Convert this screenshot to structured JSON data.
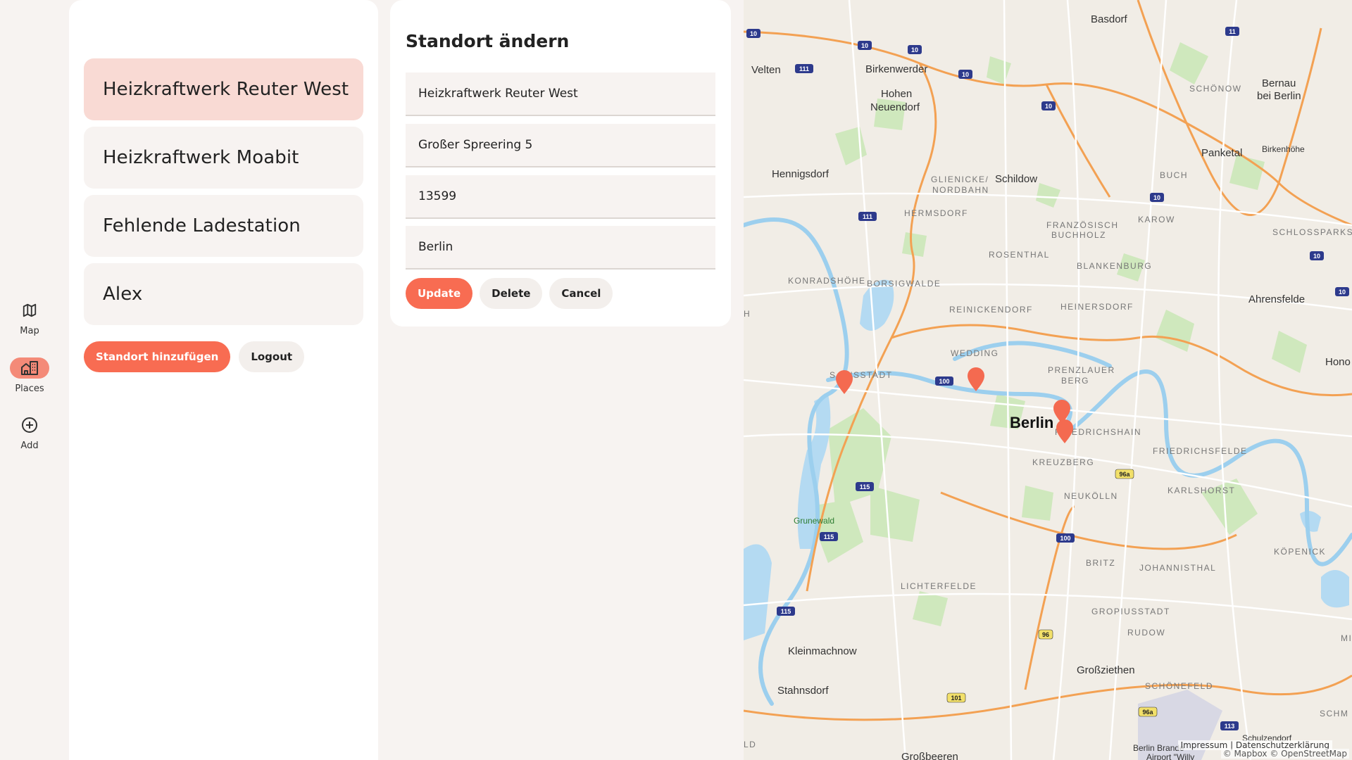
{
  "nav": {
    "items": [
      {
        "label": "Map",
        "icon": "map-icon",
        "active": false
      },
      {
        "label": "Places",
        "icon": "building-icon",
        "active": true
      },
      {
        "label": "Add",
        "icon": "plus-circle-icon",
        "active": false
      }
    ]
  },
  "places": {
    "items": [
      {
        "label": "Heizkraftwerk Reuter West",
        "selected": true
      },
      {
        "label": "Heizkraftwerk Moabit",
        "selected": false
      },
      {
        "label": "Fehlende Ladestation",
        "selected": false
      },
      {
        "label": "Alex",
        "selected": false
      }
    ],
    "add_label": "Standort hinzufügen",
    "logout_label": "Logout"
  },
  "editor": {
    "title": "Standort ändern",
    "name_value": "Heizkraftwerk Reuter West",
    "street_value": "Großer Spreering 5",
    "zip_value": "13599",
    "city_value": "Berlin",
    "update_label": "Update",
    "delete_label": "Delete",
    "cancel_label": "Cancel"
  },
  "map": {
    "labels": {
      "berlin": "Berlin",
      "basdorf": "Basdorf",
      "velten": "Velten",
      "birkenwerder": "Birkenwerder",
      "hohen": "Hohen",
      "neuendorf": "Neuendorf",
      "bernau": "Bernau",
      "bei_berlin": "bei Berlin",
      "schonow": "SCHÖNOW",
      "panketal": "Panketal",
      "birkenhohe": "Birkenhöhe",
      "hennigsdorf": "Hennigsdorf",
      "schildow": "Schildow",
      "glienicke": "GLIENICKE/",
      "nordbahn": "NORDBAHN",
      "buch": "BUCH",
      "hermsdorf": "HERMSDORF",
      "franzosisch": "FRANZÖSISCH",
      "buchholz": "BUCHHOLZ",
      "karow": "KAROW",
      "schlosspark": "SCHLOSSPARKS",
      "rosenthal": "ROSENTHAL",
      "blankenburg": "BLANKENBURG",
      "konradshohe": "KONRADSHÖHE",
      "borsigwalde": "BORSIGWALDE",
      "ahrensfelde": "Ahrensfelde",
      "reinickendorf": "REINICKENDORF",
      "heinersdorf": "HEINERSDORF",
      "wedding": "WEDDING",
      "prenzlauer": "PRENZLAUER",
      "berg": "BERG",
      "hono": "Hono",
      "siemensstadt": "S  ENSSTADT",
      "friedrichshain": "FRIEDRICHSHAIN",
      "friedrichsfelde": "FRIEDRICHSFELDE",
      "kreuzberg": "KREUZBERG",
      "karlshorst": "KARLSHORST",
      "neukolln": "NEUKÖLLN",
      "grunewald": "Grunewald",
      "kopenick": "KÖPENICK",
      "britz": "BRITZ",
      "johannisthal": "JOHANNISTHAL",
      "lichterfelde": "LICHTERFELDE",
      "gropiusstadt": "GROPIUSSTADT",
      "rudow": "RUDOW",
      "kleinmachnow": "Kleinmachnow",
      "grossziethen": "Großziethen",
      "stahnsdorf": "Stahnsdorf",
      "schonefeld": "SCHÖNEFELD",
      "schulzendorf": "Schulzendorf",
      "grossbeeren": "Großbeeren",
      "airport": "Berlin Brande",
      "airport2": "Airport \"Willy",
      "ld": "LD",
      "h": "H",
      "schm": "SCHM",
      "mi": "MI"
    },
    "shields": [
      "10",
      "10",
      "10",
      "10",
      "10",
      "10",
      "10",
      "10",
      "11",
      "111",
      "111",
      "100",
      "100",
      "115",
      "115",
      "115",
      "96a",
      "96a",
      "96",
      "101",
      "113"
    ],
    "legal": "Impressum | Datenschutzerklärung",
    "attribution": "© Mapbox © OpenStreetMap",
    "marker_color": "#f46a50"
  }
}
